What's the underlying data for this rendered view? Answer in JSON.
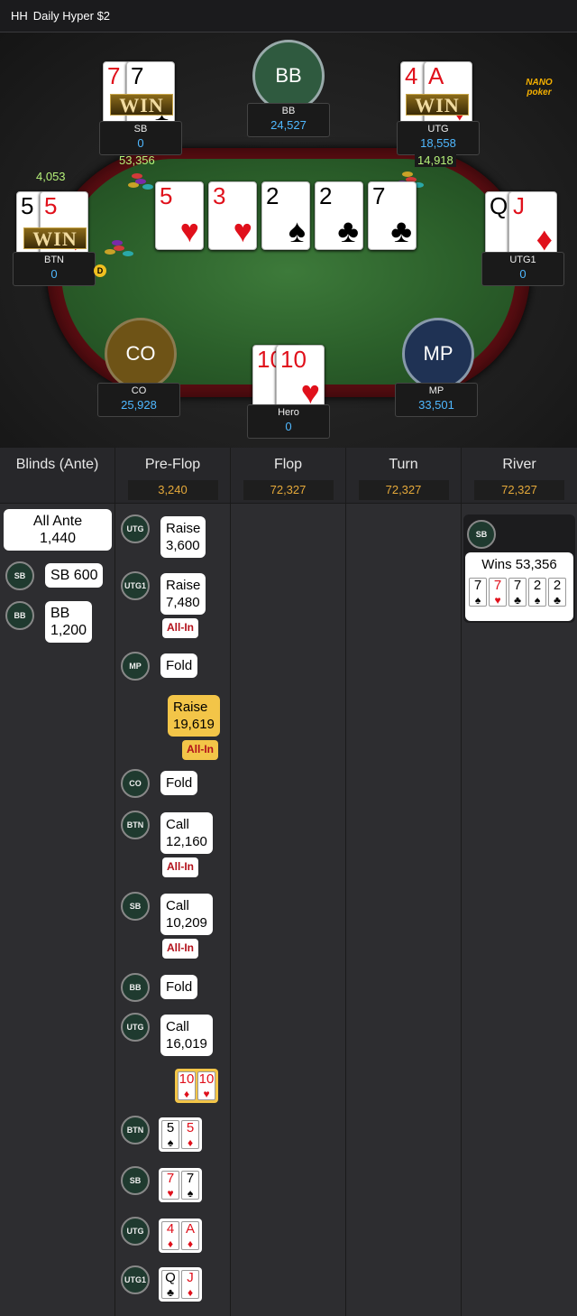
{
  "title": {
    "prefix": "HH",
    "name": "Daily Hyper $2"
  },
  "logo": "NANO poker",
  "seats": {
    "sb": {
      "name": "SB",
      "stack": "0",
      "bet": "53,356",
      "cards": [
        {
          "rank": "7",
          "suit": "♥",
          "color": "red"
        },
        {
          "rank": "7",
          "suit": "♠",
          "color": "blk"
        }
      ],
      "win": "WIN"
    },
    "bb": {
      "name": "BB",
      "stack": "24,527",
      "label": "BB"
    },
    "utg": {
      "name": "UTG",
      "stack": "18,558",
      "bet": "14,918",
      "cards": [
        {
          "rank": "4",
          "suit": "♦",
          "color": "red"
        },
        {
          "rank": "A",
          "suit": "♦",
          "color": "red"
        }
      ],
      "win": "WIN"
    },
    "btn": {
      "name": "BTN",
      "stack": "0",
      "bet": "4,053",
      "cards": [
        {
          "rank": "5",
          "suit": "♠",
          "color": "blk"
        },
        {
          "rank": "5",
          "suit": "♦",
          "color": "red"
        }
      ],
      "win": "WIN",
      "dealer": "D"
    },
    "utg1": {
      "name": "UTG1",
      "stack": "0",
      "cards": [
        {
          "rank": "Q",
          "suit": "♣",
          "color": "blk"
        },
        {
          "rank": "J",
          "suit": "♦",
          "color": "red"
        }
      ]
    },
    "co": {
      "name": "CO",
      "stack": "25,928",
      "label": "CO"
    },
    "mp": {
      "name": "MP",
      "stack": "33,501",
      "label": "MP"
    },
    "hero": {
      "name": "Hero",
      "stack": "0",
      "cards": [
        {
          "rank": "10",
          "suit": "♦",
          "color": "red"
        },
        {
          "rank": "10",
          "suit": "♥",
          "color": "red"
        }
      ]
    }
  },
  "board": [
    {
      "rank": "5",
      "suit": "♥",
      "color": "red"
    },
    {
      "rank": "3",
      "suit": "♥",
      "color": "red"
    },
    {
      "rank": "2",
      "suit": "♠",
      "color": "blk"
    },
    {
      "rank": "2",
      "suit": "♣",
      "color": "blk"
    },
    {
      "rank": "7",
      "suit": "♣",
      "color": "blk"
    }
  ],
  "columns": [
    {
      "title": "Blinds (Ante)",
      "pot": ""
    },
    {
      "title": "Pre-Flop",
      "pot": "3,240"
    },
    {
      "title": "Flop",
      "pot": "72,327"
    },
    {
      "title": "Turn",
      "pot": "72,327"
    },
    {
      "title": "River",
      "pot": "72,327"
    }
  ],
  "blinds": {
    "ante_label": "All Ante",
    "ante_value": "1,440",
    "sb_pos": "SB",
    "sb_text": "SB  600",
    "bb_pos": "BB",
    "bb_text": "BB",
    "bb_value": "1,200"
  },
  "preflop": [
    {
      "pos": "UTG",
      "action": "Raise",
      "amount": "3,600"
    },
    {
      "pos": "UTG1",
      "action": "Raise",
      "amount": "7,480",
      "allin": "All-In"
    },
    {
      "pos": "MP",
      "action": "Fold"
    },
    {
      "pos": "",
      "action": "Raise",
      "amount": "19,619",
      "allin": "All-In",
      "hero": true
    },
    {
      "pos": "CO",
      "action": "Fold"
    },
    {
      "pos": "BTN",
      "action": "Call",
      "amount": "12,160",
      "allin": "All-In"
    },
    {
      "pos": "SB",
      "action": "Call",
      "amount": "10,209",
      "allin": "All-In"
    },
    {
      "pos": "BB",
      "action": "Fold"
    },
    {
      "pos": "UTG",
      "action": "Call",
      "amount": "16,019"
    }
  ],
  "showdown": [
    {
      "pos": "",
      "cards": [
        {
          "rank": "10",
          "suit": "♦",
          "color": "red"
        },
        {
          "rank": "10",
          "suit": "♥",
          "color": "red"
        }
      ],
      "hero": true
    },
    {
      "pos": "BTN",
      "cards": [
        {
          "rank": "5",
          "suit": "♠",
          "color": "blk"
        },
        {
          "rank": "5",
          "suit": "♦",
          "color": "red"
        }
      ]
    },
    {
      "pos": "SB",
      "cards": [
        {
          "rank": "7",
          "suit": "♥",
          "color": "red"
        },
        {
          "rank": "7",
          "suit": "♠",
          "color": "blk"
        }
      ]
    },
    {
      "pos": "UTG",
      "cards": [
        {
          "rank": "4",
          "suit": "♦",
          "color": "red"
        },
        {
          "rank": "A",
          "suit": "♦",
          "color": "red"
        }
      ]
    },
    {
      "pos": "UTG1",
      "cards": [
        {
          "rank": "Q",
          "suit": "♣",
          "color": "blk"
        },
        {
          "rank": "J",
          "suit": "♦",
          "color": "red"
        }
      ]
    }
  ],
  "river": {
    "pos": "SB",
    "text": "Wins 53,356",
    "cards": [
      {
        "rank": "7",
        "suit": "♠",
        "color": "blk"
      },
      {
        "rank": "7",
        "suit": "♥",
        "color": "red"
      },
      {
        "rank": "7",
        "suit": "♣",
        "color": "blk"
      },
      {
        "rank": "2",
        "suit": "♠",
        "color": "blk"
      },
      {
        "rank": "2",
        "suit": "♣",
        "color": "blk"
      }
    ]
  }
}
